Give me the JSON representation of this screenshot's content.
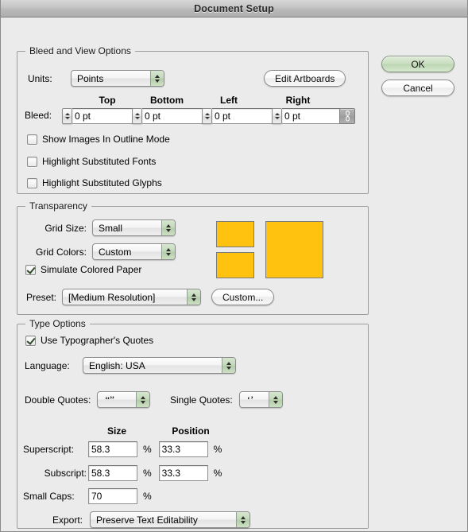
{
  "window": {
    "title": "Document Setup"
  },
  "buttons": {
    "ok": "OK",
    "cancel": "Cancel"
  },
  "colors": {
    "swatch": "#FFC20E",
    "dialog_background": "#EBEBEB",
    "default_button_tint": "#CBE0C2"
  },
  "sections": {
    "bleed_view": {
      "title": "Bleed and View Options",
      "units_label": "Units:",
      "units_value": "Points",
      "edit_artboards_button": "Edit Artboards",
      "bleed_label": "Bleed:",
      "bleed_headers": [
        "Top",
        "Bottom",
        "Left",
        "Right"
      ],
      "bleed_values": [
        "0 pt",
        "0 pt",
        "0 pt",
        "0 pt"
      ],
      "link_icon": "chain-link-icon",
      "checkboxes": [
        {
          "label": "Show Images In Outline Mode",
          "checked": false
        },
        {
          "label": "Highlight Substituted Fonts",
          "checked": false
        },
        {
          "label": "Highlight Substituted Glyphs",
          "checked": false
        }
      ]
    },
    "transparency": {
      "title": "Transparency",
      "grid_size_label": "Grid Size:",
      "grid_size_value": "Small",
      "grid_colors_label": "Grid Colors:",
      "grid_colors_value": "Custom",
      "simulate_label": "Simulate Colored Paper",
      "simulate_checked": true,
      "preset_label": "Preset:",
      "preset_value": "[Medium Resolution]",
      "custom_button": "Custom..."
    },
    "type_options": {
      "title": "Type Options",
      "typographers_quotes_label": "Use Typographer's Quotes",
      "typographers_quotes_checked": true,
      "language_label": "Language:",
      "language_value": "English: USA",
      "double_quotes_label": "Double Quotes:",
      "double_quotes_value": "“”",
      "single_quotes_label": "Single Quotes:",
      "single_quotes_value": "‘’",
      "col_size_header": "Size",
      "col_position_header": "Position",
      "superscript_label": "Superscript:",
      "superscript_size": "58.3",
      "superscript_position": "33.3",
      "subscript_label": "Subscript:",
      "subscript_size": "58.3",
      "subscript_position": "33.3",
      "small_caps_label": "Small Caps:",
      "small_caps_size": "70",
      "percent_symbol": "%",
      "export_label": "Export:",
      "export_value": "Preserve Text Editability"
    }
  }
}
